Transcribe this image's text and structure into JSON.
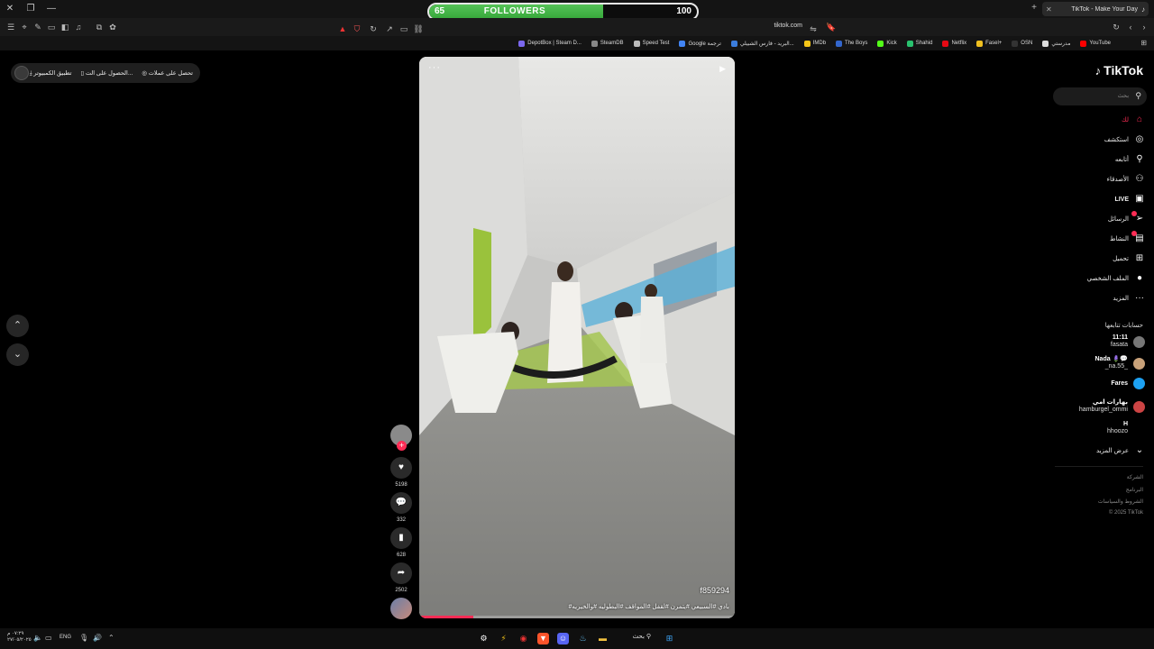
{
  "browser": {
    "tab_title": "TikTok - Make Your Day",
    "url": "tiktok.com"
  },
  "followers_widget": {
    "label": "FOLLOWERS",
    "current": "65",
    "goal": "100",
    "progress_fraction": 0.65
  },
  "bookmarks": [
    {
      "label": "YouTube",
      "color": "#ff0000"
    },
    {
      "label": "مدرستي",
      "color": "#dddddd"
    },
    {
      "label": "OSN",
      "color": "#333333"
    },
    {
      "label": "Fasel+",
      "color": "#f0c020"
    },
    {
      "label": "Netflix",
      "color": "#e50914"
    },
    {
      "label": "Shahid",
      "color": "#29c16e"
    },
    {
      "label": "Kick",
      "color": "#53fc18"
    },
    {
      "label": "The Boys",
      "color": "#3366cc"
    },
    {
      "label": "IMDb",
      "color": "#f5c518"
    },
    {
      "label": "البريد - فارس الشبيلي...",
      "color": "#3b7ddd"
    },
    {
      "label": "Google ترجمة",
      "color": "#4285f4"
    },
    {
      "label": "Speed Test",
      "color": "#bbbbbb"
    },
    {
      "label": "SteamDB",
      "color": "#888888"
    },
    {
      "label": "DepotBox | Steam D...",
      "color": "#7b68ee"
    }
  ],
  "app_pill": {
    "offers": "تحصل على عملات",
    "get_app": "الحصول على الت...",
    "desktop_app": "تطبيق الكمبيوتر"
  },
  "video": {
    "username": "f859294",
    "caption": "#بادي #السبيعي #يتمرن #لقفل #المواقف #البطوليه #والخيريه",
    "progress_fraction": 0.17
  },
  "actions": {
    "likes": "5198",
    "comments": "332",
    "saves": "628",
    "shares": "2502"
  },
  "sidebar": {
    "logo": "TikTok",
    "search_placeholder": "بحث",
    "menu": [
      {
        "label": "لك",
        "icon": "home-icon",
        "glyph": "⌂"
      },
      {
        "label": "استكشف",
        "icon": "compass-icon",
        "glyph": "◎"
      },
      {
        "label": "أتابعه",
        "icon": "user-follow-icon",
        "glyph": "⚲"
      },
      {
        "label": "الأصدقاء",
        "icon": "friends-icon",
        "glyph": "⚇"
      },
      {
        "label": "LIVE",
        "icon": "live-icon",
        "glyph": "▣"
      },
      {
        "label": "الرسائل",
        "icon": "messages-icon",
        "glyph": "➢"
      },
      {
        "label": "النشاط",
        "icon": "activity-icon",
        "glyph": "▤"
      },
      {
        "label": "تحميل",
        "icon": "upload-icon",
        "glyph": "⊞"
      },
      {
        "label": "الملف الشخصي",
        "icon": "profile-icon",
        "glyph": "●"
      },
      {
        "label": "المزيد",
        "icon": "more-icon",
        "glyph": "···"
      }
    ],
    "following_title": "حسابات تتابعها",
    "following": [
      {
        "name": "11:11",
        "handle": "fasata",
        "color": "#777777"
      },
      {
        "name": "Nada 🪻💬",
        "handle": "_na.55_",
        "color": "#c9a27a"
      },
      {
        "name": "Fares",
        "handle": "",
        "color": "#1da1f2"
      },
      {
        "name": "بهارات امي",
        "handle": "hamburgel_ommi",
        "color": "#cc4444"
      },
      {
        "name": "H",
        "handle": "hhoozo",
        "color": "#000000"
      }
    ],
    "see_more": "عرض المزيد",
    "footer": [
      "الشركة",
      "البرنامج",
      "الشروط والسياسات",
      "© 2025 TikTok"
    ]
  },
  "taskbar": {
    "search": "بحث",
    "lang": "ENG",
    "time": "٠٧:٢٩ م",
    "date": "٢٧/٠٥/٢٠٢٥"
  }
}
